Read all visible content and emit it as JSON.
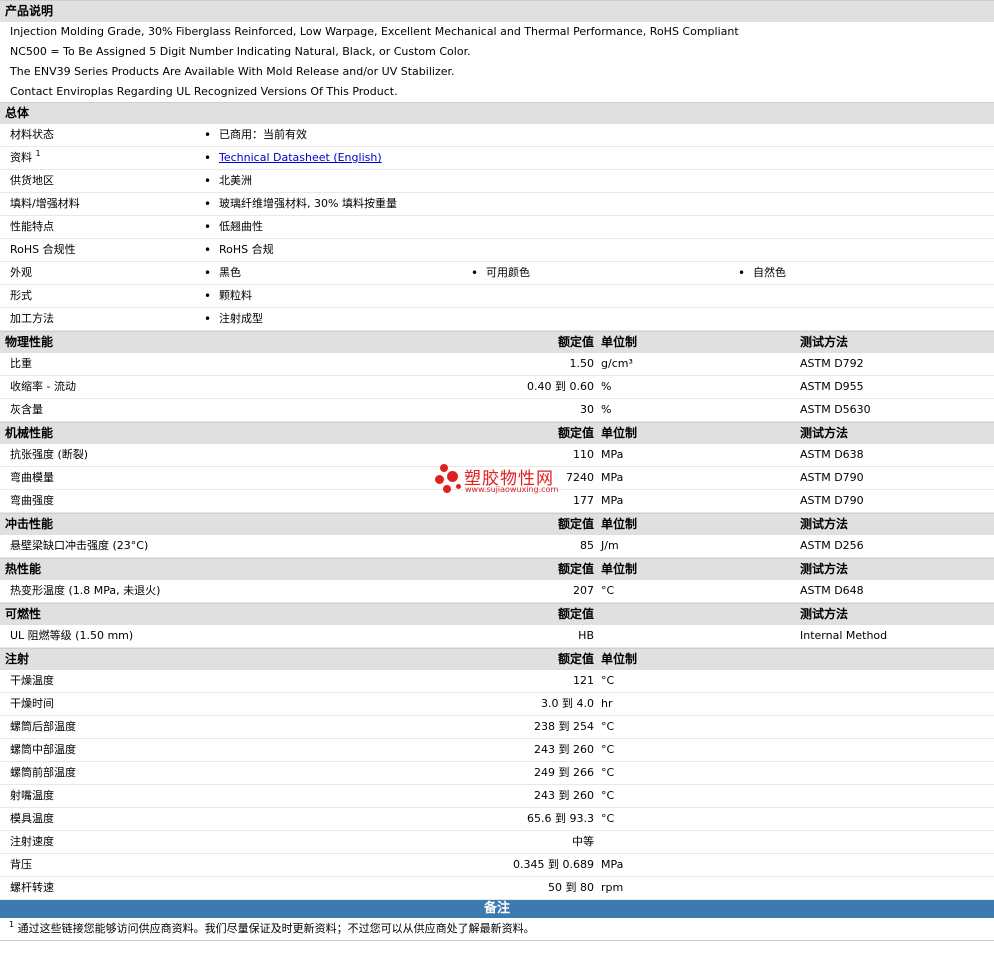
{
  "product": {
    "title": "产品说明",
    "lines": [
      "Injection Molding Grade, 30% Fiberglass Reinforced, Low Warpage, Excellent Mechanical and Thermal Performance, RoHS Compliant",
      "NC500 = To Be Assigned 5 Digit Number Indicating Natural, Black, or Custom Color.",
      "The ENV39 Series Products Are Available With Mold Release and/or UV Stabilizer.",
      "Contact Enviroplas Regarding UL Recognized Versions Of This Product."
    ]
  },
  "general": {
    "title": "总体",
    "rows": [
      {
        "label": "材料状态",
        "value": "已商用：当前有效"
      },
      {
        "label": "资料",
        "sup": "1",
        "link": "Technical Datasheet (English)"
      },
      {
        "label": "供货地区",
        "value": "北美洲"
      },
      {
        "label": "填料/增强材料",
        "value": "玻璃纤维增强材料, 30% 填料按重量"
      },
      {
        "label": "性能特点",
        "value": "低翘曲性"
      },
      {
        "label": "RoHS 合规性",
        "value": "RoHS 合规"
      },
      {
        "label": "外观",
        "values": [
          "黑色",
          "可用颜色",
          "自然色"
        ]
      },
      {
        "label": "形式",
        "value": "颗粒料"
      },
      {
        "label": "加工方法",
        "value": "注射成型"
      }
    ]
  },
  "headers": {
    "value": "额定值",
    "unit": "单位制",
    "method": "测试方法"
  },
  "sections": [
    {
      "title": "物理性能",
      "has_unit": true,
      "has_method": true,
      "rows": [
        {
          "label": "比重",
          "value": "1.50",
          "unit": "g/cm³",
          "method": "ASTM D792"
        },
        {
          "label": "收缩率 - 流动",
          "value": "0.40 到 0.60",
          "unit": "%",
          "method": "ASTM D955"
        },
        {
          "label": "灰含量",
          "value": "30",
          "unit": "%",
          "method": "ASTM D5630"
        }
      ]
    },
    {
      "title": "机械性能",
      "has_unit": true,
      "has_method": true,
      "rows": [
        {
          "label": "抗张强度 (断裂)",
          "value": "110",
          "unit": "MPa",
          "method": "ASTM D638"
        },
        {
          "label": "弯曲模量",
          "value": "7240",
          "unit": "MPa",
          "method": "ASTM D790"
        },
        {
          "label": "弯曲强度",
          "value": "177",
          "unit": "MPa",
          "method": "ASTM D790"
        }
      ]
    },
    {
      "title": "冲击性能",
      "has_unit": true,
      "has_method": true,
      "rows": [
        {
          "label": "悬壁梁缺口冲击强度 (23°C)",
          "value": "85",
          "unit": "J/m",
          "method": "ASTM D256"
        }
      ]
    },
    {
      "title": "热性能",
      "has_unit": true,
      "has_method": true,
      "rows": [
        {
          "label": "热变形温度 (1.8 MPa, 未退火)",
          "value": "207",
          "unit": "°C",
          "method": "ASTM D648"
        }
      ]
    },
    {
      "title": "可燃性",
      "has_unit": false,
      "has_method": true,
      "rows": [
        {
          "label": "UL 阻燃等级 (1.50 mm)",
          "value": "HB",
          "unit": "",
          "method": "Internal Method"
        }
      ]
    },
    {
      "title": "注射",
      "has_unit": true,
      "has_method": false,
      "rows": [
        {
          "label": "干燥温度",
          "value": "121",
          "unit": "°C",
          "method": ""
        },
        {
          "label": "干燥时间",
          "value": "3.0 到 4.0",
          "unit": "hr",
          "method": ""
        },
        {
          "label": "螺筒后部温度",
          "value": "238 到 254",
          "unit": "°C",
          "method": ""
        },
        {
          "label": "螺筒中部温度",
          "value": "243 到 260",
          "unit": "°C",
          "method": ""
        },
        {
          "label": "螺筒前部温度",
          "value": "249 到 266",
          "unit": "°C",
          "method": ""
        },
        {
          "label": "射嘴温度",
          "value": "243 到 260",
          "unit": "°C",
          "method": ""
        },
        {
          "label": "模具温度",
          "value": "65.6 到 93.3",
          "unit": "°C",
          "method": ""
        },
        {
          "label": "注射速度",
          "value": "中等",
          "unit": "",
          "method": ""
        },
        {
          "label": "背压",
          "value": "0.345 到 0.689",
          "unit": "MPa",
          "method": ""
        },
        {
          "label": "螺杆转速",
          "value": "50 到 80",
          "unit": "rpm",
          "method": ""
        }
      ]
    }
  ],
  "notes": {
    "title": "备注",
    "sup": "1",
    "text": "通过这些链接您能够访问供应商资料。我们尽量保证及时更新资料；不过您可以从供应商处了解最新资料。"
  },
  "watermark": {
    "name": "塑胶物性网",
    "url": "www.sujiaowuxing.com",
    "color": "#e02020"
  }
}
